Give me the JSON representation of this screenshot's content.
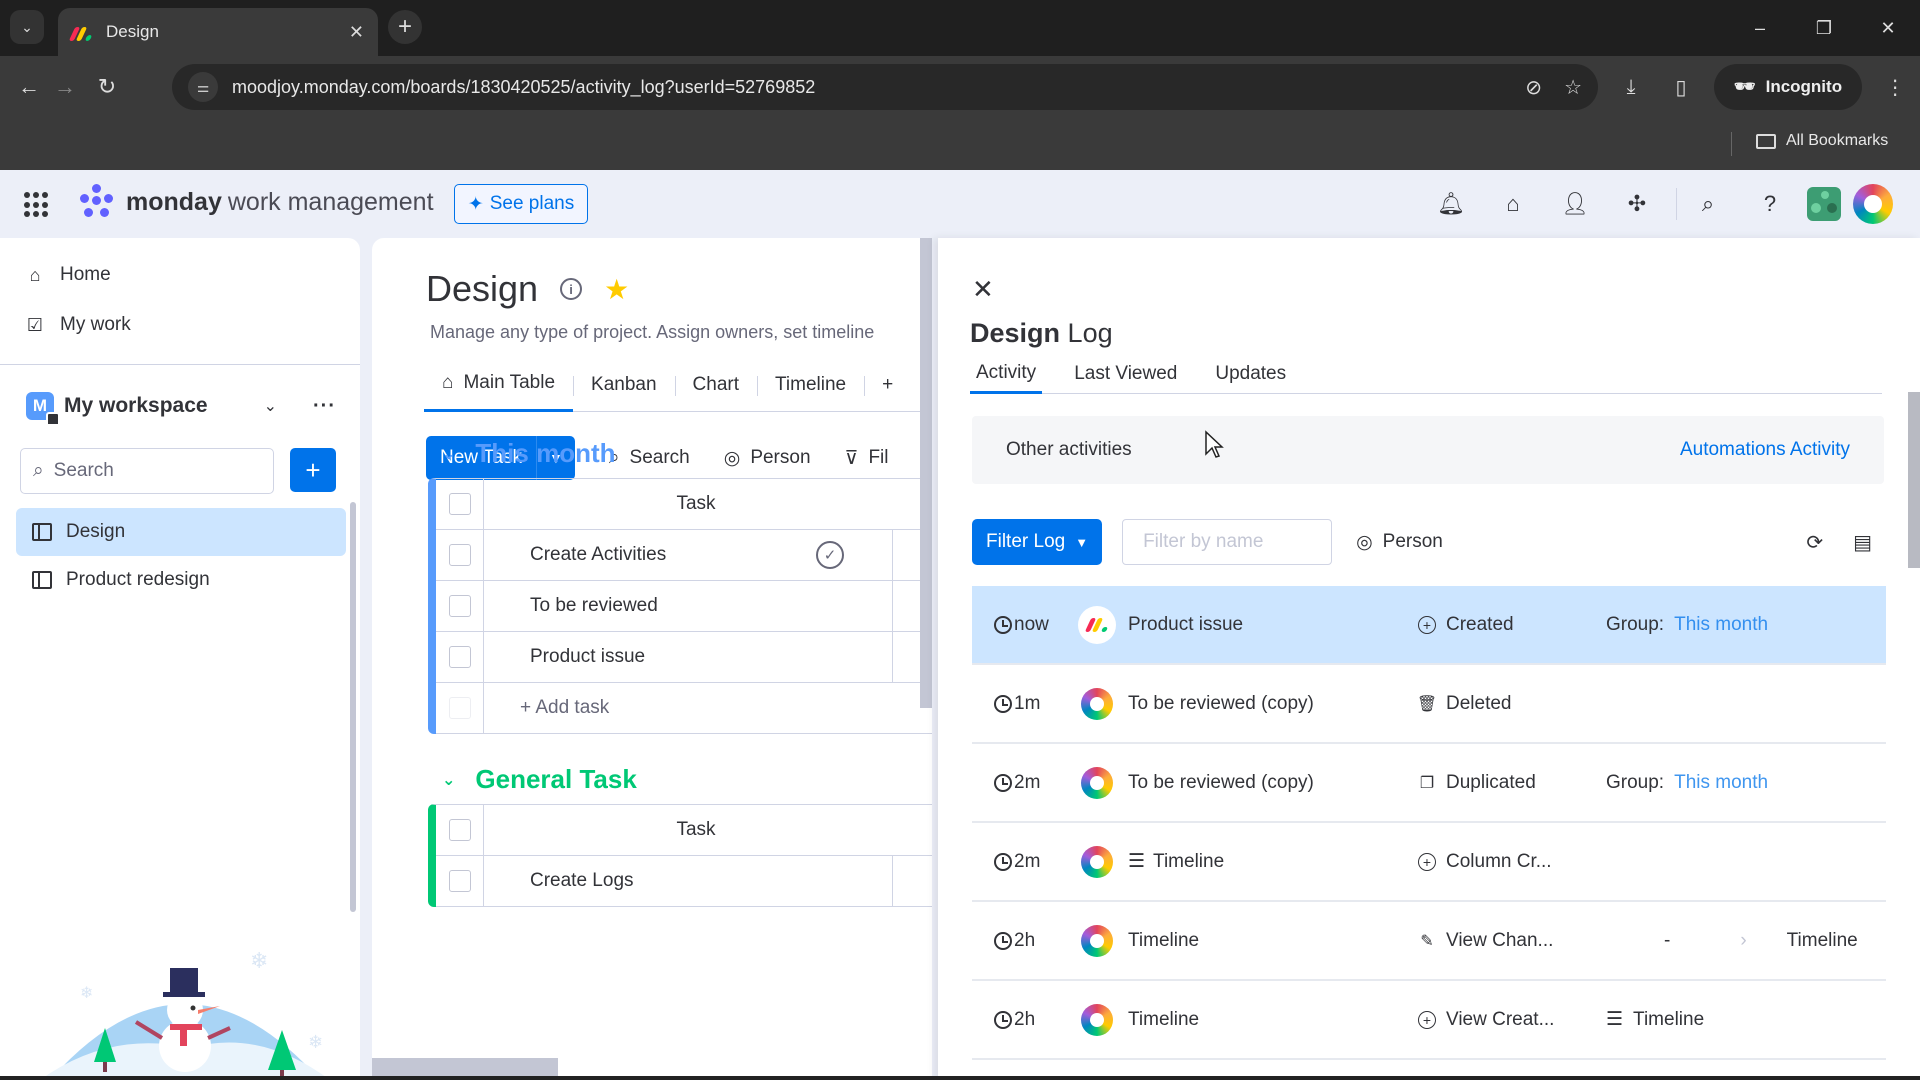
{
  "browser": {
    "tab_title": "Design",
    "url": "moodjoy.monday.com/boards/1830420525/activity_log?userId=52769852",
    "incognito_label": "Incognito",
    "bookmarks_label": "All Bookmarks"
  },
  "appbar": {
    "brand_bold": "monday",
    "brand_rest": "work management",
    "see_plans": "See plans"
  },
  "sidebar": {
    "home": "Home",
    "my_work": "My work",
    "workspace_initial": "M",
    "workspace_name": "My workspace",
    "search_placeholder": "Search",
    "boards": [
      {
        "label": "Design",
        "active": true
      },
      {
        "label": "Product redesign",
        "active": false
      }
    ]
  },
  "board": {
    "title": "Design",
    "description": "Manage any type of project. Assign owners, set timeline",
    "views": [
      "Main Table",
      "Kanban",
      "Chart",
      "Timeline",
      "+"
    ],
    "new_task": "New Task",
    "toolbar": {
      "search": "Search",
      "person": "Person",
      "filter": "Fil"
    },
    "groups": [
      {
        "name": "This month",
        "color": "#579bfc",
        "column_header": "Task",
        "rows": [
          "Create Activities",
          "To be reviewed",
          "Product issue"
        ],
        "add_label": "+ Add task"
      },
      {
        "name": "General Task",
        "color": "#00c875",
        "column_header": "Task",
        "rows": [
          "Create Logs"
        ]
      }
    ]
  },
  "log": {
    "title_bold": "Design",
    "title_rest": "Log",
    "tabs": [
      "Activity",
      "Last Viewed",
      "Updates"
    ],
    "active_tab": "Activity",
    "other_activities": "Other activities",
    "automations_activity": "Automations Activity",
    "filter_log": "Filter Log",
    "filter_placeholder": "Filter by name",
    "person": "Person",
    "entries": [
      {
        "time": "now",
        "avatar": "monday-logo",
        "item": "Product issue",
        "item_icon": "",
        "action_icon": "plus-circle-icon",
        "action": "Created",
        "detail_label": "Group:",
        "detail_value": "This month"
      },
      {
        "time": "1m",
        "avatar": "star-avatar",
        "item": "To be reviewed (copy)",
        "item_icon": "",
        "action_icon": "trash-icon",
        "action": "Deleted",
        "detail_label": "",
        "detail_value": ""
      },
      {
        "time": "2m",
        "avatar": "star-avatar",
        "item": "To be reviewed (copy)",
        "item_icon": "",
        "action_icon": "duplicate-icon",
        "action": "Duplicated",
        "detail_label": "Group:",
        "detail_value": "This month"
      },
      {
        "time": "2m",
        "avatar": "star-avatar",
        "item": "Timeline",
        "item_icon": "timeline-icon",
        "action_icon": "plus-circle-icon",
        "action": "Column Cr...",
        "detail_label": "",
        "detail_value": ""
      },
      {
        "time": "2h",
        "avatar": "star-avatar",
        "item": "Timeline",
        "item_icon": "",
        "action_icon": "pencil-icon",
        "action": "View Chan...",
        "detail_from": "-",
        "detail_to": "Timeline"
      },
      {
        "time": "2h",
        "avatar": "star-avatar",
        "item": "Timeline",
        "item_icon": "",
        "action_icon": "plus-circle-icon",
        "action": "View Creat...",
        "detail_icon": "timeline-icon",
        "detail_text": "Timeline"
      }
    ]
  },
  "colors": {
    "primary": "#0073ea",
    "selected_bg": "#cce5ff",
    "group_blue": "#579bfc",
    "group_green": "#00c875",
    "star": "#ffcb00"
  }
}
